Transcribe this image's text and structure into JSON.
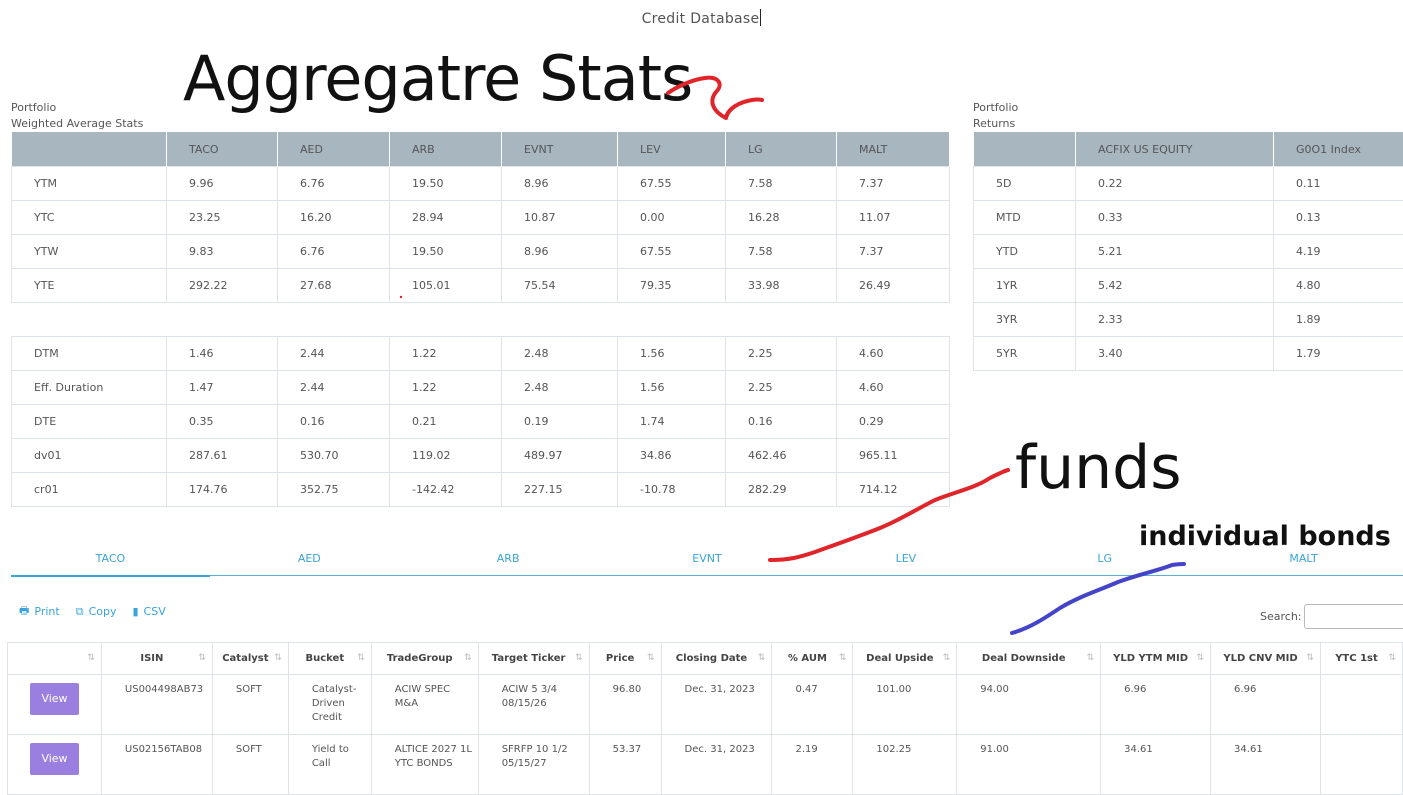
{
  "app": {
    "title": "Credit Database"
  },
  "annotations": {
    "aggregate": "Aggregatre Stats",
    "funds": "funds",
    "bonds": "individual bonds",
    "colors": {
      "red": "#e0252a",
      "blue": "#4444c8"
    }
  },
  "weighted": {
    "caption_line1": "Portfolio",
    "caption_line2": "Weighted Average Stats",
    "headers": [
      "",
      "TACO",
      "AED",
      "ARB",
      "EVNT",
      "LEV",
      "LG",
      "MALT"
    ],
    "rows_top": [
      [
        "YTM",
        "9.96",
        "6.76",
        "19.50",
        "8.96",
        "67.55",
        "7.58",
        "7.37"
      ],
      [
        "YTC",
        "23.25",
        "16.20",
        "28.94",
        "10.87",
        "0.00",
        "16.28",
        "11.07"
      ],
      [
        "YTW",
        "9.83",
        "6.76",
        "19.50",
        "8.96",
        "67.55",
        "7.58",
        "7.37"
      ],
      [
        "YTE",
        "292.22",
        "27.68",
        "105.01",
        "75.54",
        "79.35",
        "33.98",
        "26.49"
      ]
    ],
    "rows_bottom": [
      [
        "DTM",
        "1.46",
        "2.44",
        "1.22",
        "2.48",
        "1.56",
        "2.25",
        "4.60"
      ],
      [
        "Eff. Duration",
        "1.47",
        "2.44",
        "1.22",
        "2.48",
        "1.56",
        "2.25",
        "4.60"
      ],
      [
        "DTE",
        "0.35",
        "0.16",
        "0.21",
        "0.19",
        "1.74",
        "0.16",
        "0.29"
      ],
      [
        "dv01",
        "287.61",
        "530.70",
        "119.02",
        "489.97",
        "34.86",
        "462.46",
        "965.11"
      ],
      [
        "cr01",
        "174.76",
        "352.75",
        "-142.42",
        "227.15",
        "-10.78",
        "282.29",
        "714.12"
      ]
    ]
  },
  "returns": {
    "caption_line1": "Portfolio",
    "caption_line2": "Returns",
    "headers": [
      "",
      "ACFIX US EQUITY",
      "G0O1 Index"
    ],
    "rows": [
      [
        "5D",
        "0.22",
        "0.11"
      ],
      [
        "MTD",
        "0.33",
        "0.13"
      ],
      [
        "YTD",
        "5.21",
        "4.19"
      ],
      [
        "1YR",
        "5.42",
        "4.80"
      ],
      [
        "3YR",
        "2.33",
        "1.89"
      ],
      [
        "5YR",
        "3.40",
        "1.79"
      ]
    ]
  },
  "tabs": [
    "TACO",
    "AED",
    "ARB",
    "EVNT",
    "LEV",
    "LG",
    "MALT"
  ],
  "toolbar": {
    "print": "Print",
    "copy": "Copy",
    "csv": "CSV",
    "search_label": "Search:",
    "search_value": ""
  },
  "bonds": {
    "headers": [
      "",
      "ISIN",
      "Catalyst",
      "Bucket",
      "TradeGroup",
      "Target Ticker",
      "Price",
      "Closing Date",
      "% AUM",
      "Deal Upside",
      "Deal Downside",
      "YLD YTM MID",
      "YLD CNV MID",
      "YTC 1st"
    ],
    "view_label": "View",
    "rows": [
      [
        "US004498AB73",
        "SOFT",
        "Catalyst-Driven Credit",
        "ACIW SPEC M&A",
        "ACIW 5 3/4 08/15/26",
        "96.80",
        "Dec. 31, 2023",
        "0.47",
        "101.00",
        "94.00",
        "6.96",
        "6.96",
        ""
      ],
      [
        "US02156TAB08",
        "SOFT",
        "Yield to Call",
        "ALTICE 2027 1L YTC BONDS",
        "SFRFP 10 1/2 05/15/27",
        "53.37",
        "Dec. 31, 2023",
        "2.19",
        "102.25",
        "91.00",
        "34.61",
        "34.61",
        ""
      ]
    ]
  }
}
